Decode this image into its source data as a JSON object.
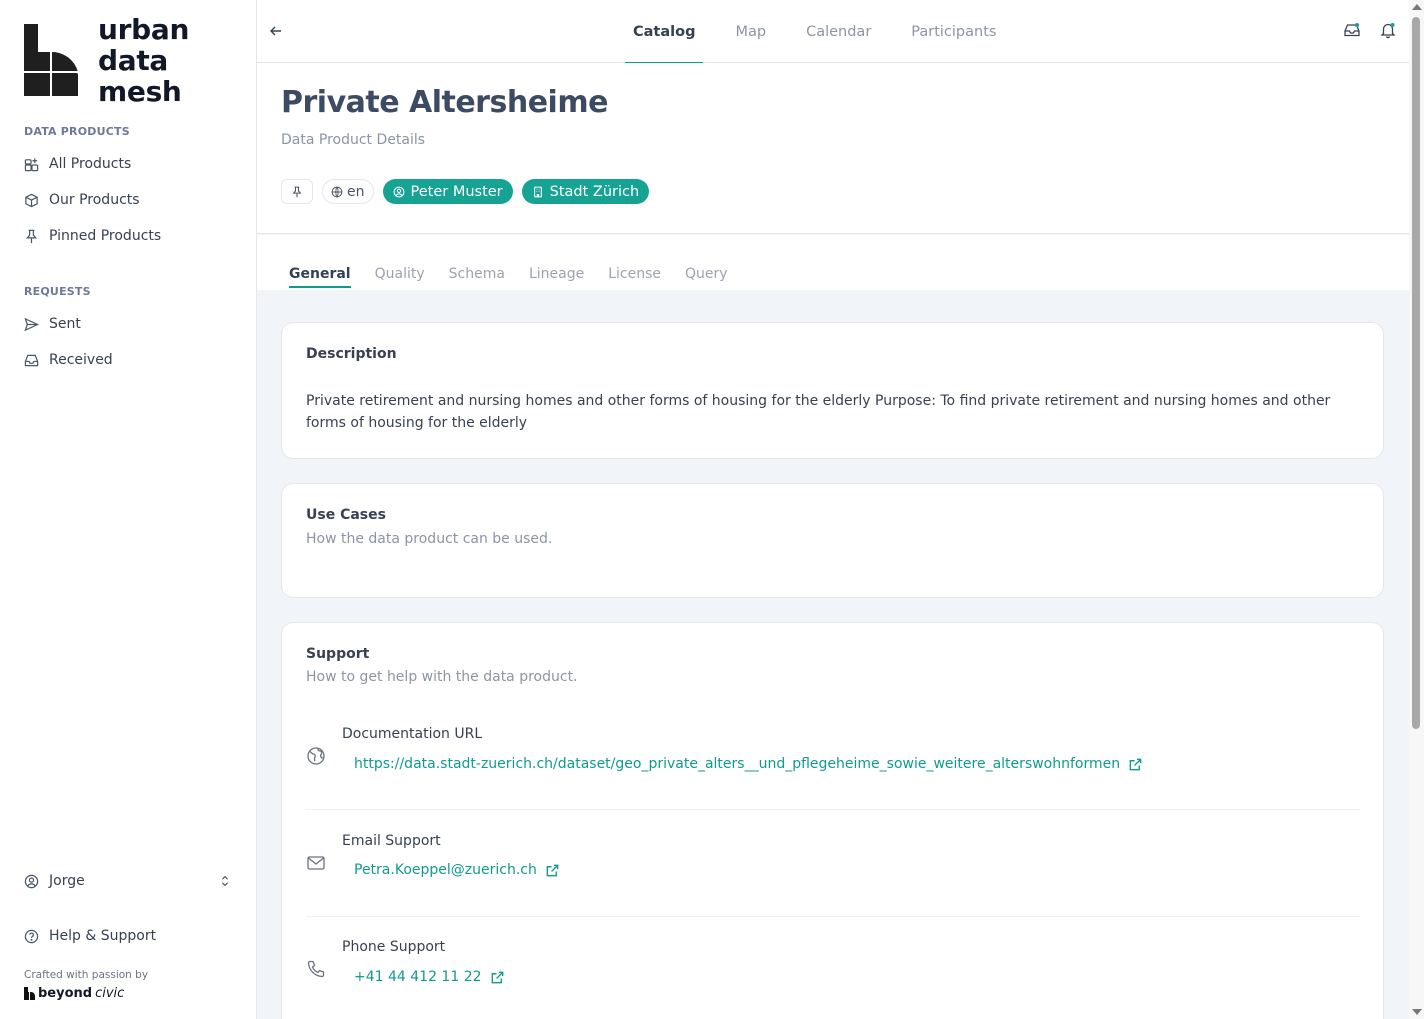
{
  "app": {
    "logo_lines": [
      "urban",
      "data",
      "mesh"
    ]
  },
  "sidebar": {
    "data_products_title": "DATA PRODUCTS",
    "data_products": [
      {
        "label": "All Products",
        "icon": "grid-plus-icon"
      },
      {
        "label": "Our Products",
        "icon": "cube-icon"
      },
      {
        "label": "Pinned Products",
        "icon": "pin-icon"
      }
    ],
    "requests_title": "REQUESTS",
    "requests": [
      {
        "label": "Sent",
        "icon": "send-icon"
      },
      {
        "label": "Received",
        "icon": "inbox-icon"
      }
    ],
    "user_name": "Jorge",
    "help_label": "Help & Support",
    "crafted": "Crafted with passion by",
    "brand_bold": "beyond",
    "brand_italic": "civic"
  },
  "topnav": {
    "tabs": [
      "Catalog",
      "Map",
      "Calendar",
      "Participants"
    ],
    "active_tab": "Catalog"
  },
  "header": {
    "title": "Private Altersheime",
    "subtitle": "Data Product Details",
    "language": "en",
    "owner": "Peter Muster",
    "organization": "Stadt Zürich"
  },
  "sub_tabs": {
    "items": [
      "General",
      "Quality",
      "Schema",
      "Lineage",
      "License",
      "Query"
    ],
    "active": "General"
  },
  "description": {
    "title": "Description",
    "text": "Private retirement and nursing homes and other forms of housing for the elderly Purpose: To find private retirement and nursing homes and other forms of housing for the elderly"
  },
  "use_cases": {
    "title": "Use Cases",
    "subtitle": "How the data product can be used."
  },
  "support": {
    "title": "Support",
    "subtitle": "How to get help with the data product.",
    "items": [
      {
        "label": "Documentation URL",
        "value": "https://data.stadt-zuerich.ch/dataset/geo_private_alters__und_pflegeheime_sowie_weitere_alterswohnformen",
        "icon": "globe-icon"
      },
      {
        "label": "Email Support",
        "value": "Petra.Koeppel@zuerich.ch",
        "icon": "mail-icon"
      },
      {
        "label": "Phone Support",
        "value": "+41 44 412 11 22",
        "icon": "phone-icon"
      }
    ]
  },
  "colors": {
    "accent": "#0f9b8e",
    "badge": "#16a394",
    "background": "#f1f5f9"
  }
}
